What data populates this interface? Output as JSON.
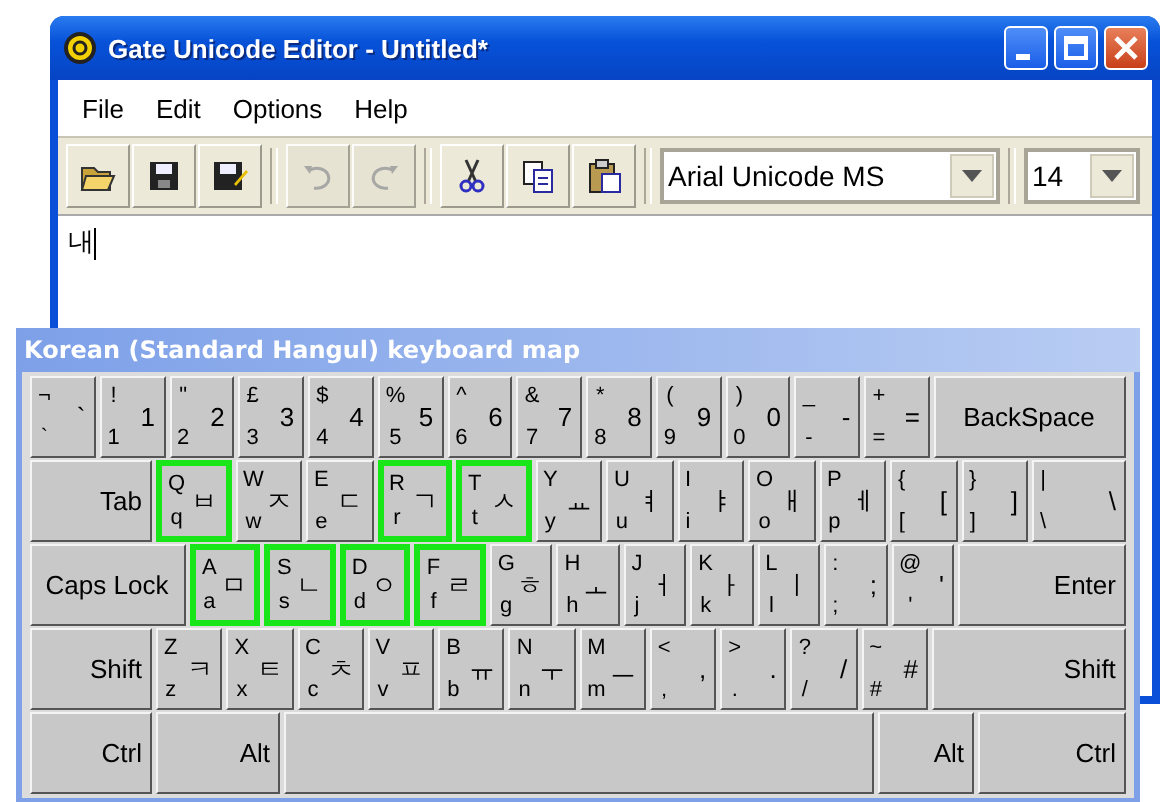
{
  "window": {
    "title": "Gate Unicode Editor - Untitled*"
  },
  "menu": [
    "File",
    "Edit",
    "Options",
    "Help"
  ],
  "toolbar": [
    {
      "kind": "open",
      "disabled": false
    },
    {
      "kind": "save",
      "disabled": false
    },
    {
      "kind": "saveas",
      "disabled": false
    },
    {
      "kind": "sep"
    },
    {
      "kind": "undo",
      "disabled": true
    },
    {
      "kind": "redo",
      "disabled": true
    },
    {
      "kind": "sep"
    },
    {
      "kind": "cut",
      "disabled": false
    },
    {
      "kind": "copy",
      "disabled": false
    },
    {
      "kind": "paste",
      "disabled": false
    }
  ],
  "font": {
    "value": "Arial Unicode MS"
  },
  "size": {
    "value": "14"
  },
  "editor": {
    "text": "내"
  },
  "keyboard": {
    "title": "Korean (Standard Hangul) keyboard map",
    "rows": [
      {
        "keys": [
          {
            "kind": "char",
            "upper": "¬",
            "lower": "`",
            "main": "`",
            "selected": false
          },
          {
            "kind": "char",
            "upper": "!",
            "lower": "1",
            "main": "1",
            "selected": false
          },
          {
            "kind": "char",
            "upper": "\"",
            "lower": "2",
            "main": "2",
            "selected": false
          },
          {
            "kind": "char",
            "upper": "£",
            "lower": "3",
            "main": "3",
            "selected": false
          },
          {
            "kind": "char",
            "upper": "$",
            "lower": "4",
            "main": "4",
            "selected": false
          },
          {
            "kind": "char",
            "upper": "%",
            "lower": "5",
            "main": "5",
            "selected": false
          },
          {
            "kind": "char",
            "upper": "^",
            "lower": "6",
            "main": "6",
            "selected": false
          },
          {
            "kind": "char",
            "upper": "&",
            "lower": "7",
            "main": "7",
            "selected": false
          },
          {
            "kind": "char",
            "upper": "*",
            "lower": "8",
            "main": "8",
            "selected": false
          },
          {
            "kind": "char",
            "upper": "(",
            "lower": "9",
            "main": "9",
            "selected": false
          },
          {
            "kind": "char",
            "upper": ")",
            "lower": "0",
            "main": "0",
            "selected": false
          },
          {
            "kind": "char",
            "upper": "_",
            "lower": "-",
            "main": "-",
            "selected": false
          },
          {
            "kind": "char",
            "upper": "+",
            "lower": "=",
            "main": "=",
            "selected": false
          },
          {
            "kind": "backspace",
            "label": "BackSpace",
            "selected": false
          }
        ]
      },
      {
        "keys": [
          {
            "kind": "tab",
            "label": "Tab",
            "selected": false
          },
          {
            "kind": "char",
            "upper": "Q",
            "lower": "q",
            "main": "ㅂ",
            "selected": true
          },
          {
            "kind": "char",
            "upper": "W",
            "lower": "w",
            "main": "ㅈ",
            "selected": false
          },
          {
            "kind": "char",
            "upper": "E",
            "lower": "e",
            "main": "ㄷ",
            "selected": false
          },
          {
            "kind": "char",
            "upper": "R",
            "lower": "r",
            "main": "ㄱ",
            "selected": true
          },
          {
            "kind": "char",
            "upper": "T",
            "lower": "t",
            "main": "ㅅ",
            "selected": true
          },
          {
            "kind": "char",
            "upper": "Y",
            "lower": "y",
            "main": "ㅛ",
            "selected": false
          },
          {
            "kind": "char",
            "upper": "U",
            "lower": "u",
            "main": "ㅕ",
            "selected": false
          },
          {
            "kind": "char",
            "upper": "I",
            "lower": "i",
            "main": "ㅑ",
            "selected": false
          },
          {
            "kind": "char",
            "upper": "O",
            "lower": "o",
            "main": "ㅐ",
            "selected": false
          },
          {
            "kind": "char",
            "upper": "P",
            "lower": "p",
            "main": "ㅔ",
            "selected": false
          },
          {
            "kind": "char",
            "upper": "{",
            "lower": "[",
            "main": "[",
            "selected": false
          },
          {
            "kind": "char",
            "upper": "}",
            "lower": "]",
            "main": "]",
            "selected": false
          },
          {
            "kind": "backslash",
            "upper": "|",
            "lower": "\\",
            "main": "\\",
            "selected": false
          }
        ]
      },
      {
        "keys": [
          {
            "kind": "caps",
            "label": "Caps Lock",
            "selected": false
          },
          {
            "kind": "char",
            "upper": "A",
            "lower": "a",
            "main": "ㅁ",
            "selected": true
          },
          {
            "kind": "char",
            "upper": "S",
            "lower": "s",
            "main": "ㄴ",
            "selected": true
          },
          {
            "kind": "char",
            "upper": "D",
            "lower": "d",
            "main": "ㅇ",
            "selected": true
          },
          {
            "kind": "char",
            "upper": "F",
            "lower": "f",
            "main": "ㄹ",
            "selected": true
          },
          {
            "kind": "char",
            "upper": "G",
            "lower": "g",
            "main": "ㅎ",
            "selected": false
          },
          {
            "kind": "char",
            "upper": "H",
            "lower": "h",
            "main": "ㅗ",
            "selected": false
          },
          {
            "kind": "char",
            "upper": "J",
            "lower": "j",
            "main": "ㅓ",
            "selected": false
          },
          {
            "kind": "char",
            "upper": "K",
            "lower": "k",
            "main": "ㅏ",
            "selected": false
          },
          {
            "kind": "char",
            "upper": "L",
            "lower": "l",
            "main": "ㅣ",
            "selected": false
          },
          {
            "kind": "char",
            "upper": ":",
            "lower": ";",
            "main": ";",
            "selected": false
          },
          {
            "kind": "char",
            "upper": "@",
            "lower": "'",
            "main": "'",
            "selected": false
          },
          {
            "kind": "enter",
            "label": "Enter",
            "selected": false
          }
        ]
      },
      {
        "keys": [
          {
            "kind": "shift",
            "label": "Shift",
            "selected": false
          },
          {
            "kind": "char",
            "upper": "Z",
            "lower": "z",
            "main": "ㅋ",
            "selected": false
          },
          {
            "kind": "char",
            "upper": "X",
            "lower": "x",
            "main": "ㅌ",
            "selected": false
          },
          {
            "kind": "char",
            "upper": "C",
            "lower": "c",
            "main": "ㅊ",
            "selected": false
          },
          {
            "kind": "char",
            "upper": "V",
            "lower": "v",
            "main": "ㅍ",
            "selected": false
          },
          {
            "kind": "char",
            "upper": "B",
            "lower": "b",
            "main": "ㅠ",
            "selected": false
          },
          {
            "kind": "char",
            "upper": "N",
            "lower": "n",
            "main": "ㅜ",
            "selected": false
          },
          {
            "kind": "char",
            "upper": "M",
            "lower": "m",
            "main": "ㅡ",
            "selected": false
          },
          {
            "kind": "char",
            "upper": "<",
            "lower": ",",
            "main": ",",
            "selected": false
          },
          {
            "kind": "char",
            "upper": ">",
            "lower": ".",
            "main": ".",
            "selected": false
          },
          {
            "kind": "char",
            "upper": "?",
            "lower": "/",
            "main": "/",
            "selected": false
          },
          {
            "kind": "char",
            "upper": "~",
            "lower": "#",
            "main": "#",
            "selected": false
          },
          {
            "kind": "rshift",
            "label": "Shift",
            "selected": false
          }
        ]
      },
      {
        "keys": [
          {
            "kind": "ctrl",
            "label": "Ctrl",
            "selected": false
          },
          {
            "kind": "alt",
            "label": "Alt",
            "selected": false
          },
          {
            "kind": "space",
            "selected": false
          },
          {
            "kind": "ralt",
            "label": "Alt",
            "selected": false
          },
          {
            "kind": "rctrl",
            "label": "Ctrl",
            "selected": false
          }
        ]
      }
    ]
  }
}
